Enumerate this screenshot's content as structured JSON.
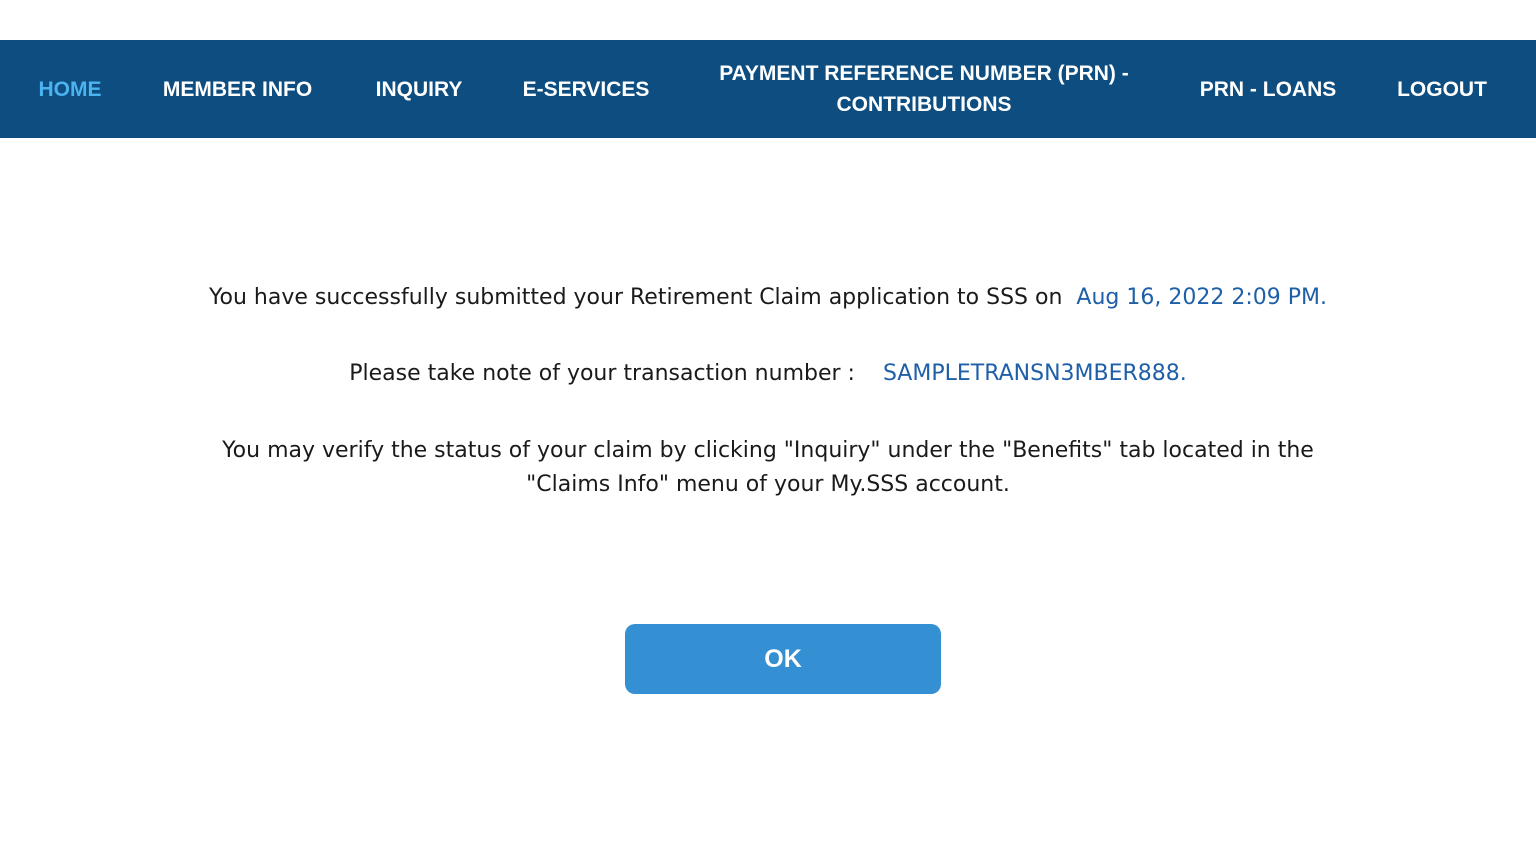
{
  "nav": {
    "home": "HOME",
    "member_info": "MEMBER INFO",
    "inquiry": "INQUIRY",
    "e_services": "E-SERVICES",
    "prn_contributions_line1": "PAYMENT REFERENCE NUMBER (PRN) -",
    "prn_contributions_line2": "CONTRIBUTIONS",
    "prn_loans": "PRN - LOANS",
    "logout": "LOGOUT"
  },
  "message": {
    "line1_text": "You have successfully submitted your Retirement Claim application to SSS on",
    "line1_date": "Aug 16, 2022 2:09 PM.",
    "line2_text": "Please take note of your transaction number :",
    "line2_txn": "SAMPLETRANSN3MBER888.",
    "line3a": "You may verify the status of your claim by clicking \"Inquiry\" under the \"Benefits\" tab located in the",
    "line3b": "\"Claims Info\" menu of your My.SSS account."
  },
  "ok_button": "OK",
  "colors": {
    "nav_bg": "#0d4d80",
    "active_nav": "#4ab3f0",
    "highlight_text": "#1f5fa8",
    "button_bg": "#3590d3"
  }
}
